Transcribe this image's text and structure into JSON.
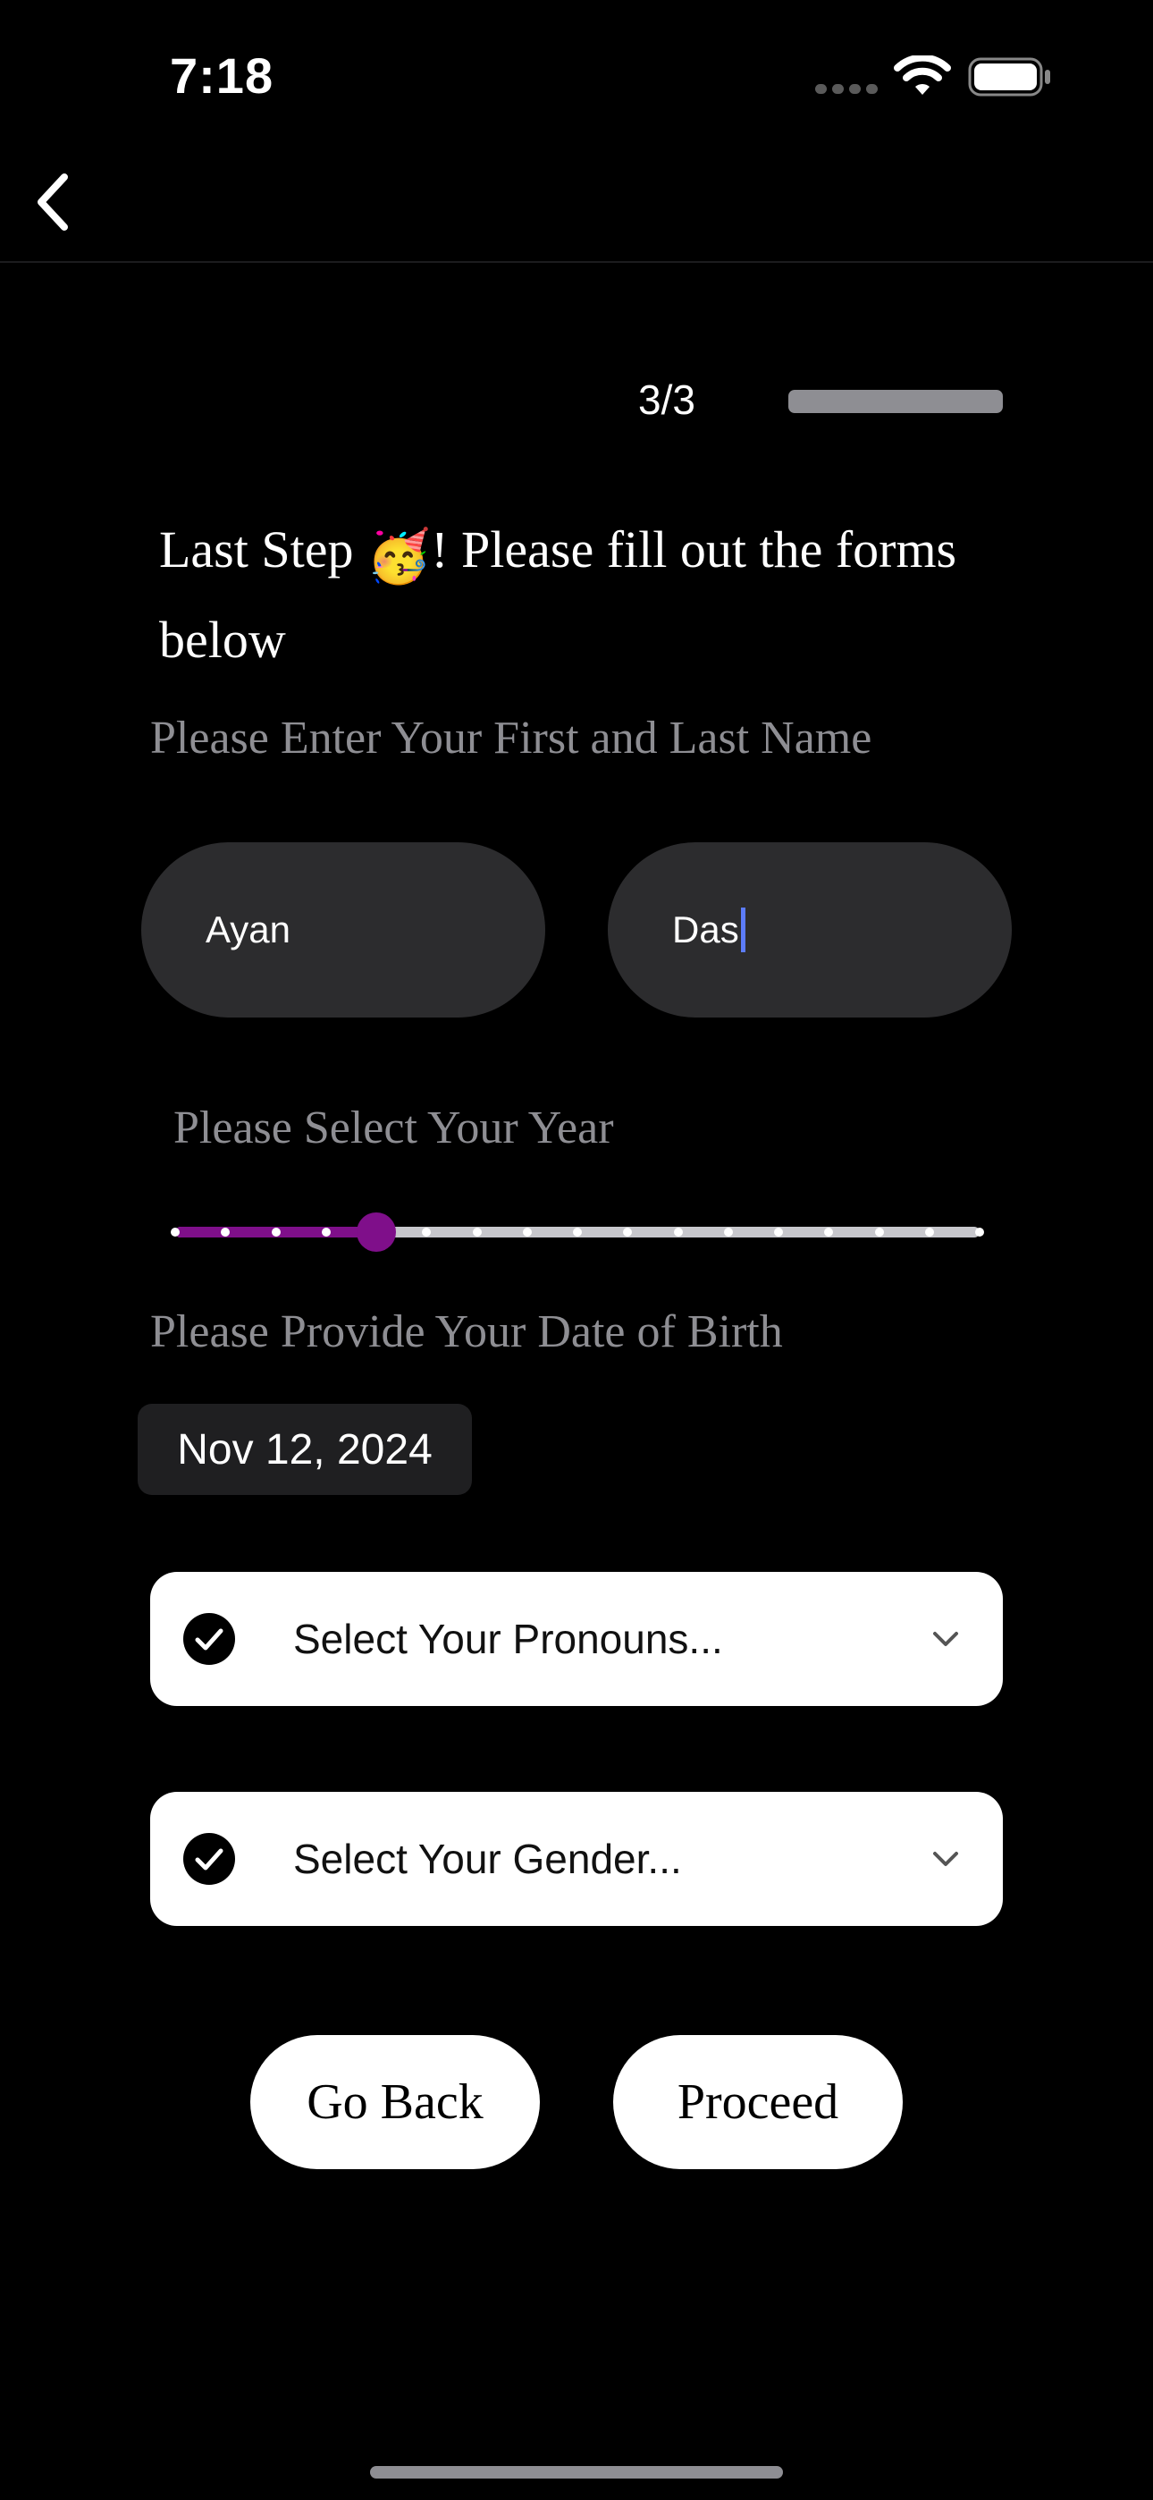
{
  "status_bar": {
    "time": "7:18"
  },
  "nav": {
    "back_icon": "chevron-left-icon"
  },
  "progress": {
    "step_label": "3/3",
    "fraction": 1.0
  },
  "heading": {
    "before_emoji": "Last Step ",
    "emoji": "🥳",
    "after_emoji": "! Please fill out the forms below"
  },
  "name_section": {
    "label": "Please Enter Your First and Last Name",
    "first_name": "Ayan",
    "last_name": "Das"
  },
  "year_section": {
    "label": "Please Select Your Year",
    "slider_steps": 17,
    "slider_selected_index": 4
  },
  "dob_section": {
    "label": "Please Provide Your Date of Birth",
    "date_value": "Nov 12, 2024"
  },
  "pronouns_dropdown": {
    "placeholder": "Select Your Pronouns..."
  },
  "gender_dropdown": {
    "placeholder": "Select Your Gender..."
  },
  "actions": {
    "go_back_label": "Go Back",
    "proceed_label": "Proceed"
  },
  "colors": {
    "background": "#000000",
    "field_bg": "#2c2c2e",
    "slider_accent": "#7f0f8a",
    "caret": "#5c7cfa",
    "muted_text": "#8e8e93"
  }
}
